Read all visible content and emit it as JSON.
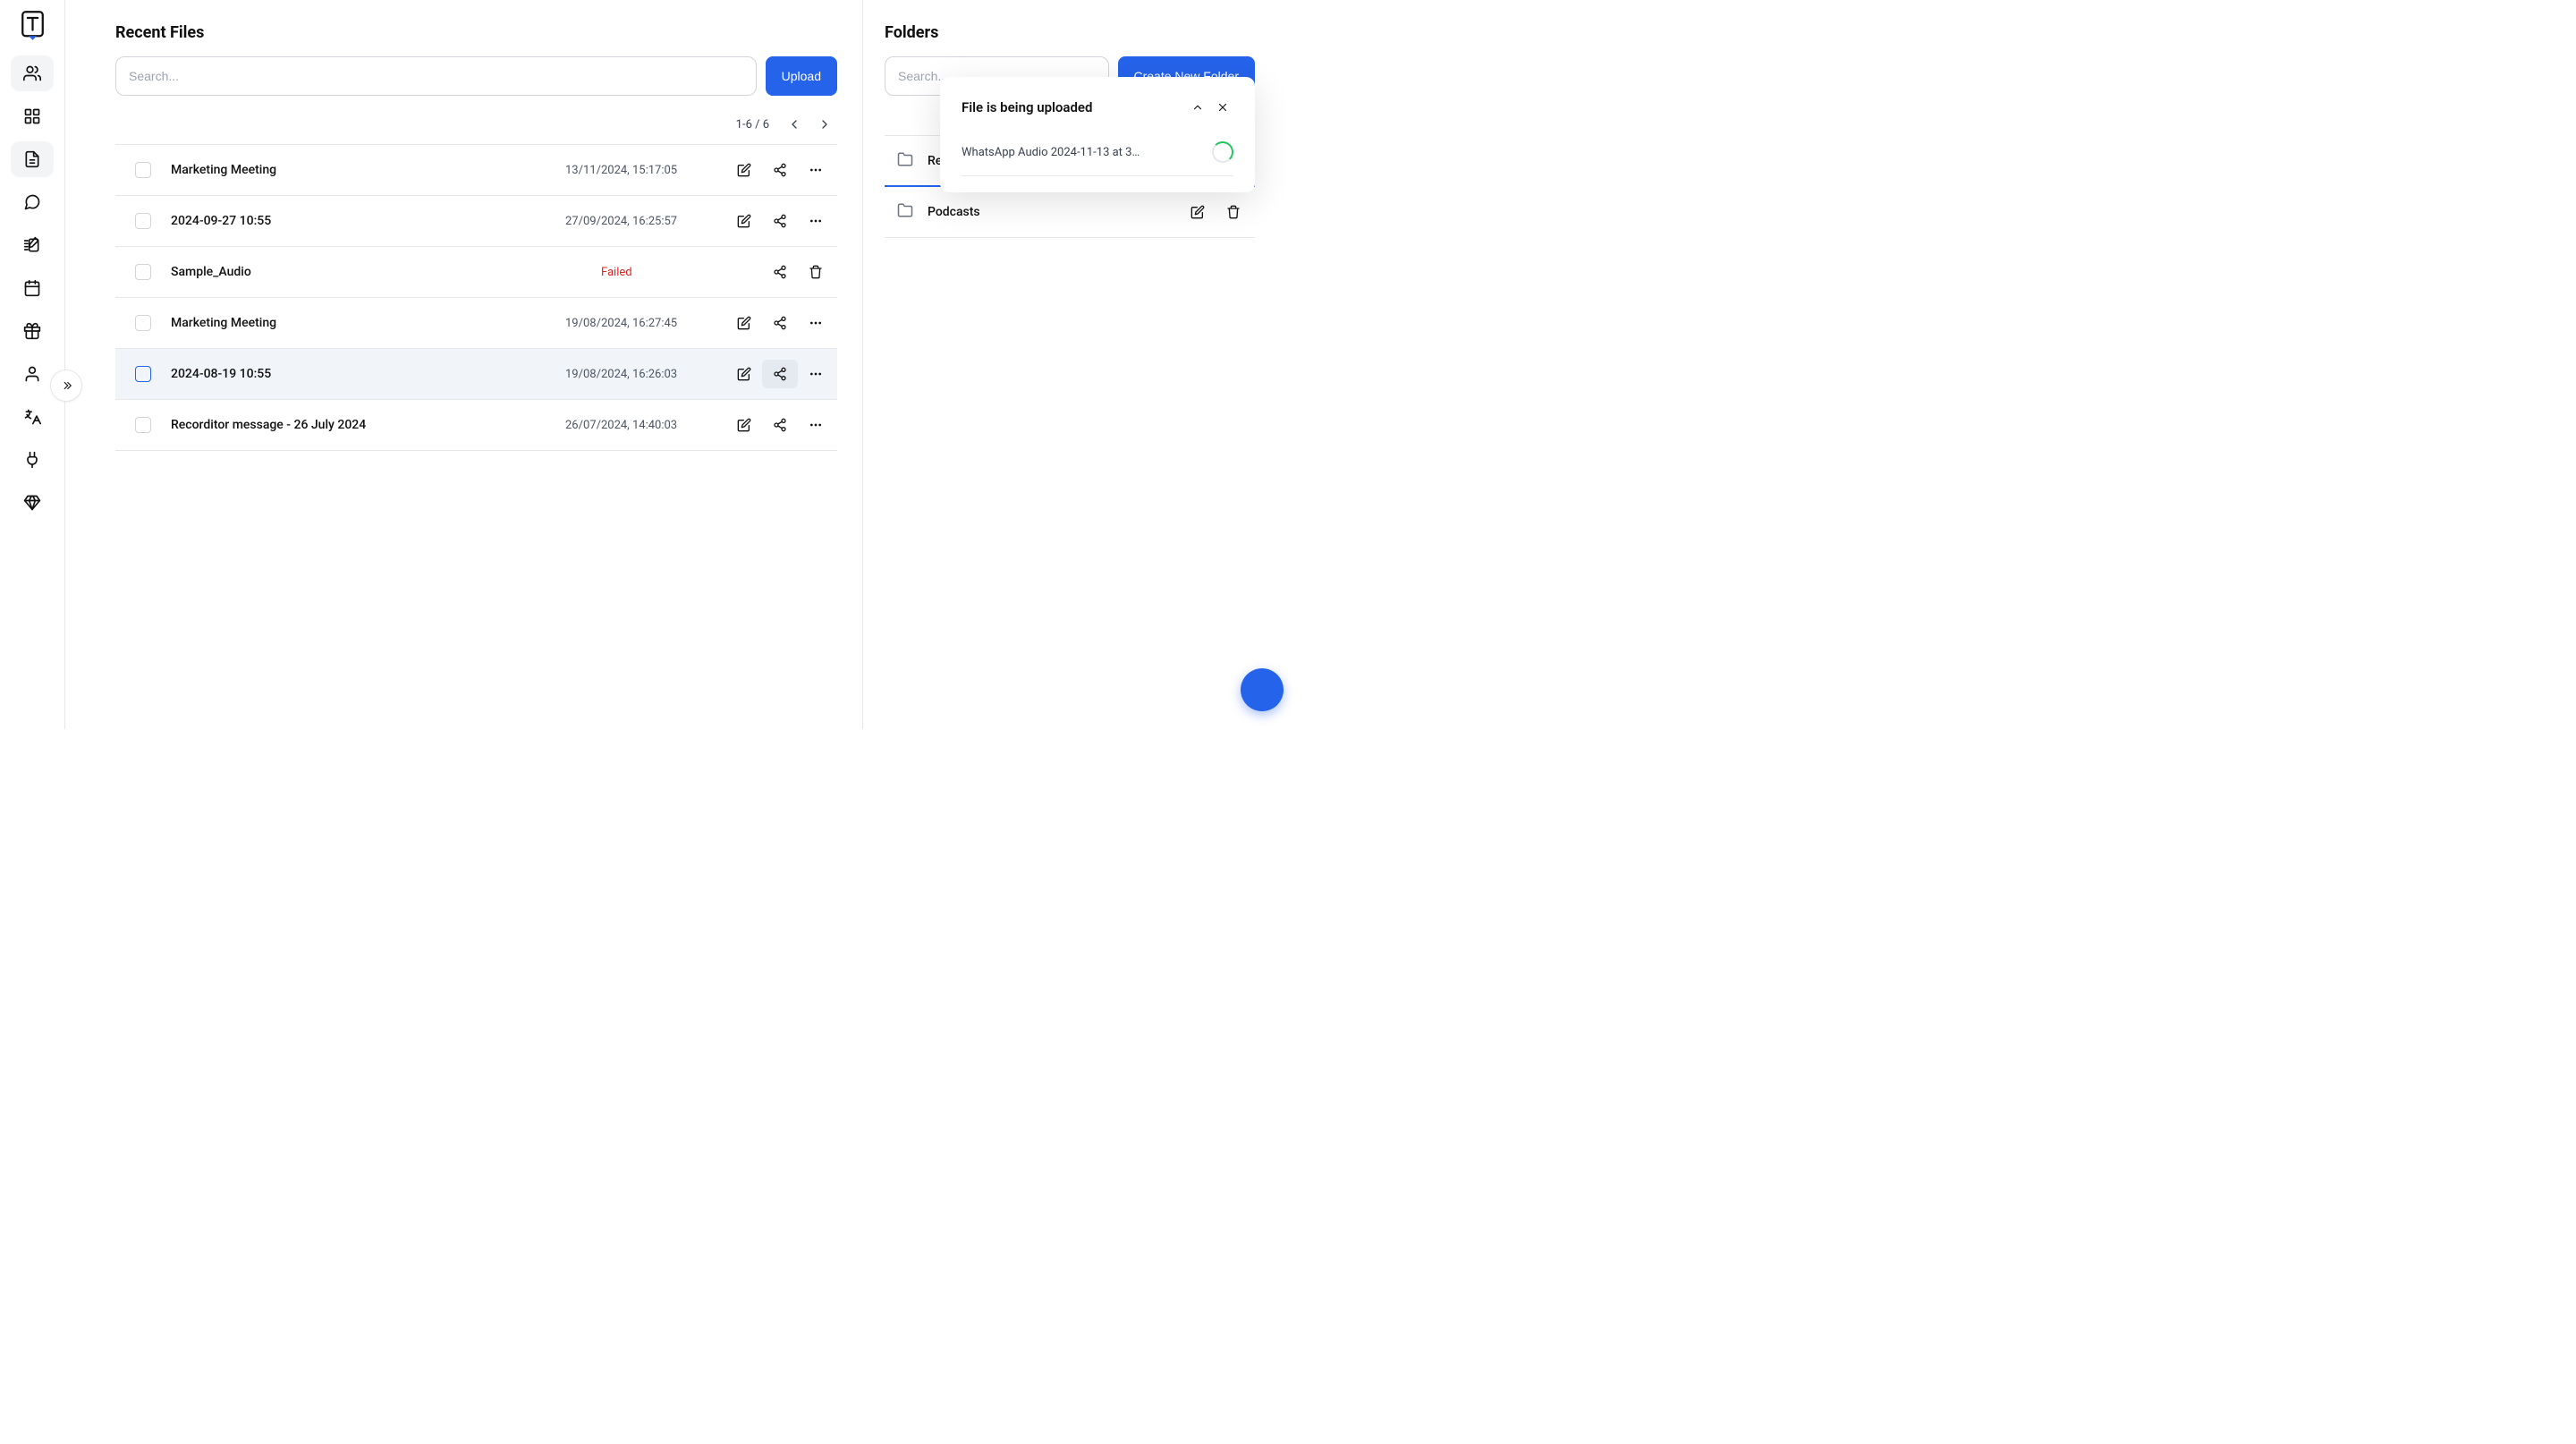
{
  "files_panel": {
    "title": "Recent Files",
    "search_placeholder": "Search...",
    "upload_label": "Upload",
    "pager_text": "1-6 / 6"
  },
  "folders_panel": {
    "title": "Folders",
    "search_placeholder": "Search...",
    "create_label": "Create New Folder"
  },
  "files": [
    {
      "name": "Marketing Meeting",
      "date": "13/11/2024, 15:17:05",
      "status": "ok"
    },
    {
      "name": "2024-09-27 10:55",
      "date": "27/09/2024, 16:25:57",
      "status": "ok"
    },
    {
      "name": "Sample_Audio",
      "date": "",
      "status": "failed",
      "status_label": "Failed"
    },
    {
      "name": "Marketing Meeting",
      "date": "19/08/2024, 16:27:45",
      "status": "ok"
    },
    {
      "name": "2024-08-19 10:55",
      "date": "19/08/2024, 16:26:03",
      "status": "ok"
    },
    {
      "name": "Recorditor message - 26 July 2024",
      "date": "26/07/2024, 14:40:03",
      "status": "ok"
    }
  ],
  "folders": [
    {
      "name": "Rec"
    },
    {
      "name": "Podcasts"
    }
  ],
  "toast": {
    "title": "File is being uploaded",
    "file_name": "WhatsApp Audio 2024-11-13 at 3…"
  }
}
